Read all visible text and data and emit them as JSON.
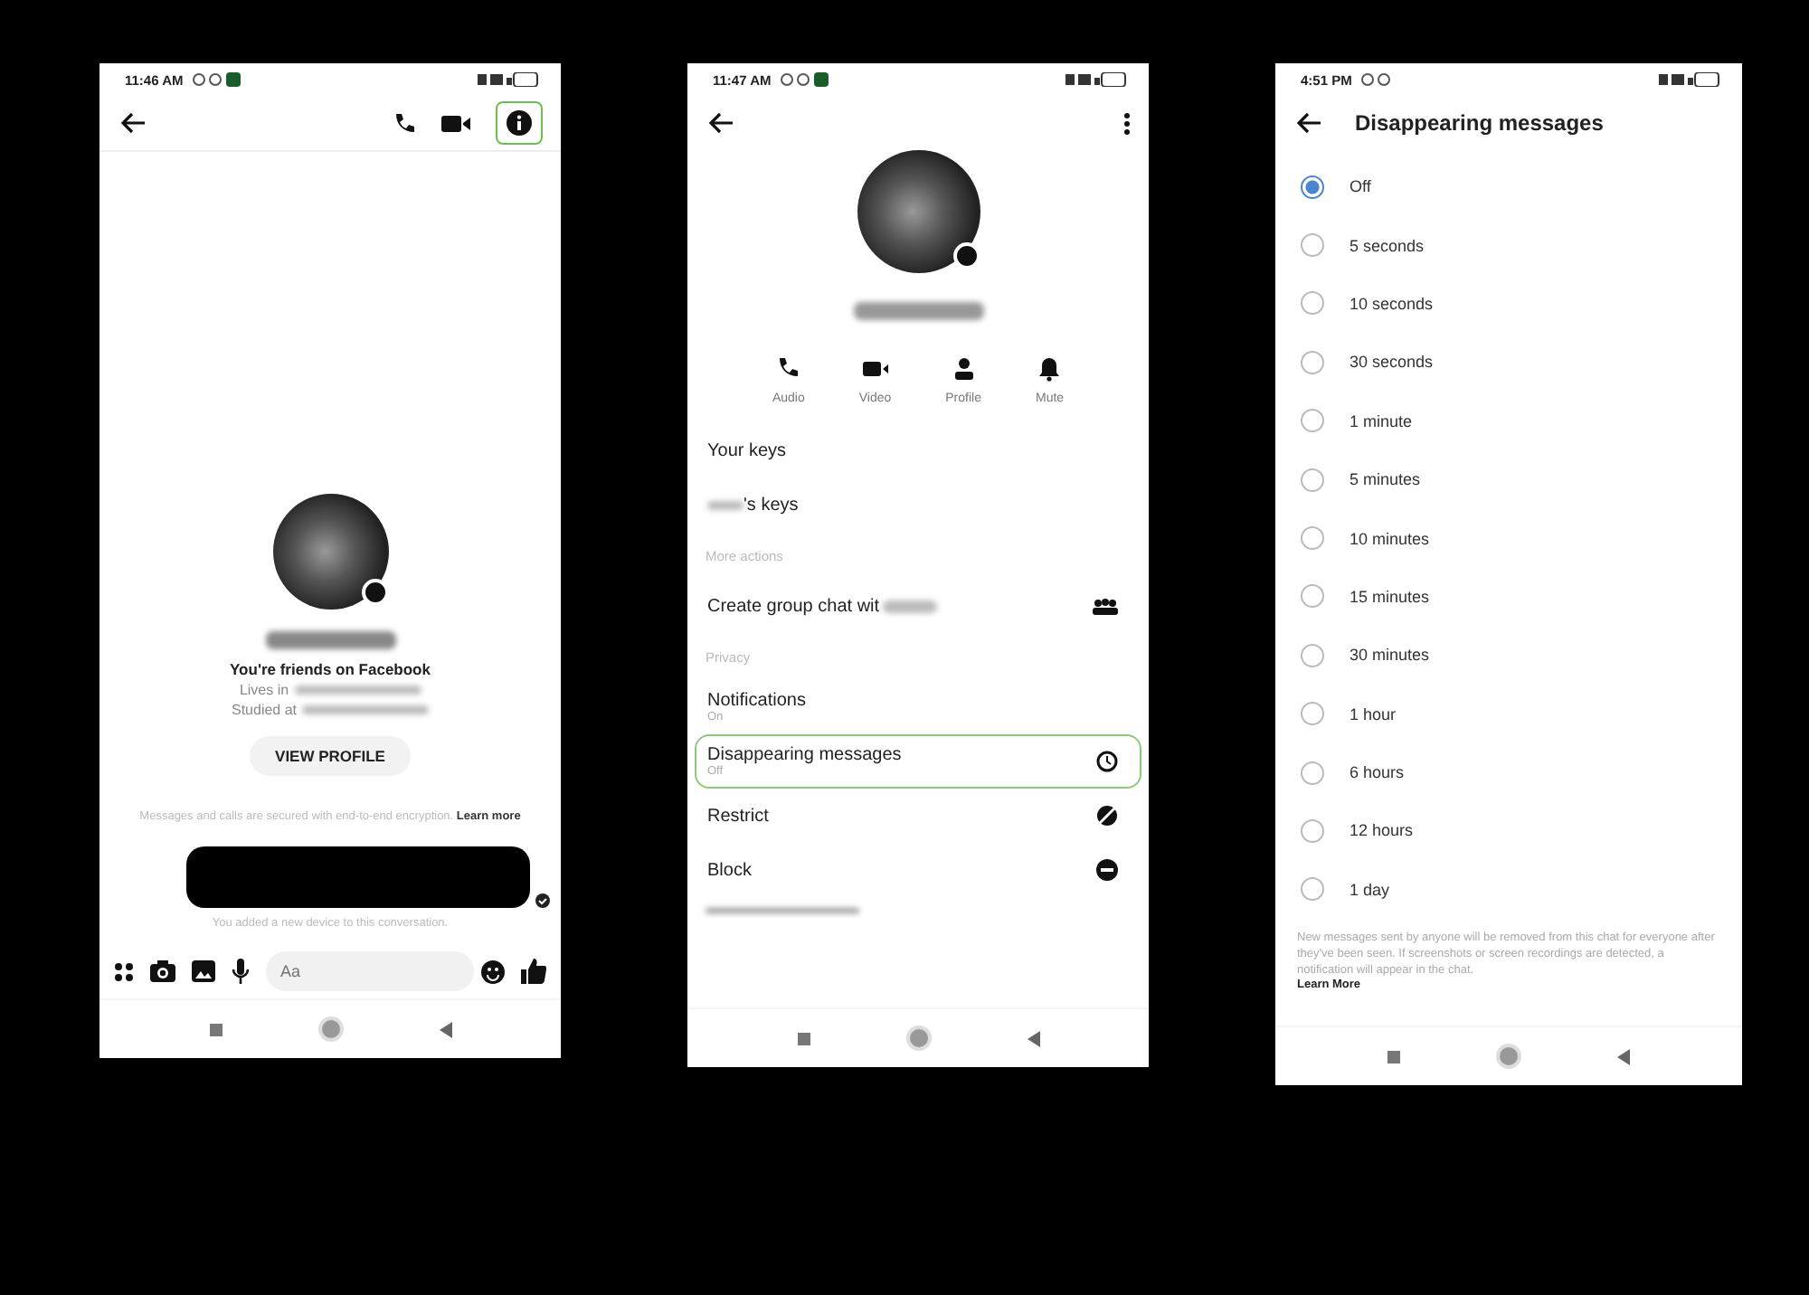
{
  "chat_screen": {
    "status_time": "11:46 AM",
    "info_button": {
      "highlighted": true
    },
    "friends_text": "You're friends on Facebook",
    "lives_in_label": "Lives in",
    "studied_at_label": "Studied at",
    "view_profile_button": "VIEW PROFILE",
    "encryption_note": "Messages and calls are secured with end-to-end encryption.",
    "learn_more": "Learn more",
    "system_note": "You added a new device to this conversation.",
    "composer": {
      "placeholder": "Aa"
    }
  },
  "details_screen": {
    "status_time": "11:47 AM",
    "actions": [
      "Audio",
      "Video",
      "Profile",
      "Mute"
    ],
    "rows": [
      {
        "kind": "item",
        "label": "Your keys",
        "highlighted": false
      },
      {
        "kind": "redacted_prefix",
        "label": "'s keys",
        "highlighted": false
      },
      {
        "kind": "header",
        "label": "More actions"
      },
      {
        "kind": "redacted_suffix",
        "label": "Create group chat wit",
        "highlighted": false
      },
      {
        "kind": "header",
        "label": "Privacy"
      },
      {
        "kind": "item",
        "label": "Notifications",
        "sublabel": "On",
        "highlighted": false
      },
      {
        "kind": "item",
        "label": "Disappearing messages",
        "sublabel": "Off",
        "highlighted": true
      },
      {
        "kind": "item",
        "label": "Restrict",
        "highlighted": false
      },
      {
        "kind": "item",
        "label": "Block",
        "highlighted": false
      }
    ]
  },
  "disappearing_screen": {
    "status_time": "4:51 PM",
    "title": "Disappearing messages",
    "options": [
      {
        "label": "Off",
        "selected": true
      },
      {
        "label": "5 seconds",
        "selected": false
      },
      {
        "label": "10 seconds",
        "selected": false
      },
      {
        "label": "30 seconds",
        "selected": false
      },
      {
        "label": "1 minute",
        "selected": false
      },
      {
        "label": "5 minutes",
        "selected": false
      },
      {
        "label": "10 minutes",
        "selected": false
      },
      {
        "label": "15 minutes",
        "selected": false
      },
      {
        "label": "30 minutes",
        "selected": false
      },
      {
        "label": "1 hour",
        "selected": false
      },
      {
        "label": "6 hours",
        "selected": false
      },
      {
        "label": "12 hours",
        "selected": false
      },
      {
        "label": "1 day",
        "selected": false
      }
    ],
    "note": "New messages sent by anyone will be removed from this chat for everyone after they've been seen. If screenshots or screen recordings are detected, a notification will appear in the chat.",
    "learn_more": "Learn More"
  }
}
